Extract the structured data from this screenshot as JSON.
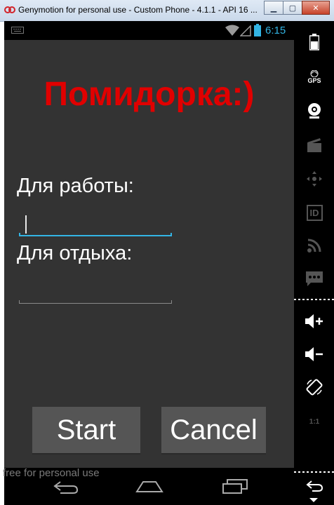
{
  "window": {
    "title": "Genymotion for personal use - Custom Phone - 4.1.1 - API 16 ..."
  },
  "status_bar": {
    "time": "6:15",
    "time_color": "#33b5e5"
  },
  "app": {
    "title": "Помидорка:)",
    "title_color": "#e00000",
    "work_label": "Для работы:",
    "work_value": "",
    "rest_label": "Для отдыха:",
    "rest_value": "",
    "start_button": "Start",
    "cancel_button": "Cancel",
    "accent": "#33b5e5"
  },
  "watermark": "free for personal use",
  "sidebar": {
    "icons": [
      "battery-icon",
      "gps-icon",
      "webcam-icon",
      "clapperboard-icon",
      "dpad-icon",
      "id-icon",
      "rss-icon",
      "message-icon",
      "volume-up-icon",
      "volume-down-icon",
      "rotate-icon",
      "scale-icon",
      "back-icon"
    ],
    "gps_label": "GPS",
    "id_label": "ID",
    "scale_label": "1:1"
  },
  "nav": [
    "back-icon",
    "home-icon",
    "recents-icon"
  ]
}
